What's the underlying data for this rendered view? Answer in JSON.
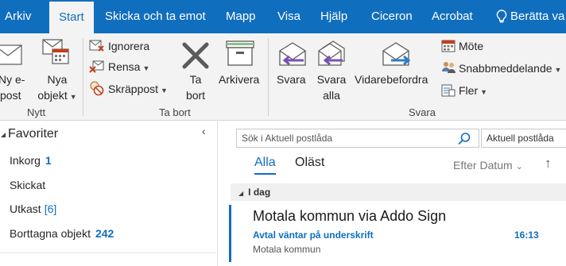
{
  "colors": {
    "accent": "#106ebe",
    "ribbon_bg": "#f3f3f3"
  },
  "tabs": [
    "Arkiv",
    "Start",
    "Skicka och ta emot",
    "Mapp",
    "Visa",
    "Hjälp",
    "Ciceron",
    "Acrobat"
  ],
  "tell_me": "Berätta va",
  "ribbon": {
    "new_email_line1": "Ny e-",
    "new_email_line2": "post",
    "new_items_line1": "Nya",
    "new_items_line2": "objekt",
    "group_new": "Nytt",
    "ignore": "Ignorera",
    "clean_up": "Rensa",
    "junk": "Skräppost",
    "delete_line1": "Ta",
    "delete_line2": "bort",
    "archive": "Arkivera",
    "group_delete": "Ta bort",
    "reply": "Svara",
    "reply_all_line1": "Svara",
    "reply_all_line2": "alla",
    "forward": "Vidarebefordra",
    "meeting": "Möte",
    "im": "Snabbmeddelande",
    "more": "Fler",
    "group_respond": "Svara"
  },
  "folders": {
    "favorites_title": "Favoriter",
    "items": [
      {
        "label": "Inkorg",
        "count": "1"
      },
      {
        "label": "Skickat",
        "count": ""
      },
      {
        "label": "Utkast",
        "count": "[6]"
      },
      {
        "label": "Borttagna objekt",
        "count": "242"
      }
    ]
  },
  "search": {
    "placeholder": "Sök i Aktuell postlåda",
    "scope": "Aktuell postlåda"
  },
  "list": {
    "filter_all": "Alla",
    "filter_unread": "Oläst",
    "sort": "Efter Datum",
    "group": "I dag",
    "messages": [
      {
        "sender": "Motala kommun via Addo Sign",
        "subject": "Avtal väntar på underskrift",
        "time": "16:13",
        "preview": "Motala kommun"
      }
    ]
  }
}
